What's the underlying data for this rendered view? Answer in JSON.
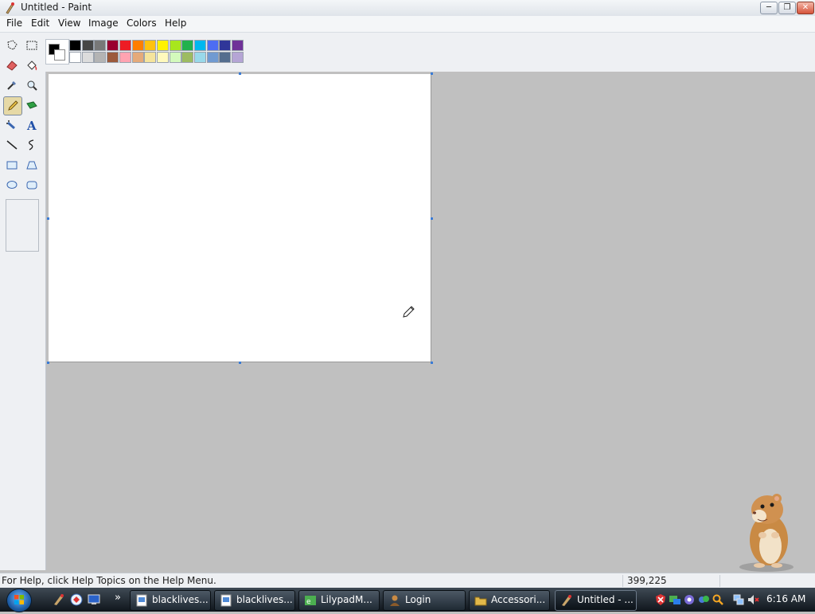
{
  "window": {
    "title": "Untitled - Paint",
    "minimize_glyph": "─",
    "restore_glyph": "❐",
    "close_glyph": "✕"
  },
  "menubar": {
    "items": [
      "File",
      "Edit",
      "View",
      "Image",
      "Colors",
      "Help"
    ]
  },
  "toolbox": {
    "tools": [
      "free-form-select",
      "select",
      "eraser",
      "fill-with-color",
      "pick-color",
      "magnifier",
      "pencil",
      "brush",
      "airbrush",
      "text",
      "line",
      "curve",
      "rectangle",
      "polygon",
      "ellipse",
      "rounded-rectangle"
    ],
    "active_tool": "pencil"
  },
  "palette": {
    "foreground": "#000000",
    "background": "#ffffff",
    "row1": [
      "#000000",
      "#464646",
      "#787878",
      "#990030",
      "#ed1c24",
      "#ff7e00",
      "#ffc20e",
      "#fff200",
      "#a8e61d",
      "#22b14c",
      "#00b7ef",
      "#4d6df3",
      "#2f3699",
      "#6f3198"
    ],
    "row2": [
      "#ffffff",
      "#dcdcdc",
      "#b4b4b4",
      "#9c5a3c",
      "#ffa3b1",
      "#e5aa7a",
      "#f5e49c",
      "#fff9bd",
      "#d3f9bc",
      "#9dbb61",
      "#99d9ea",
      "#709ad1",
      "#546d8e",
      "#b5a5d5"
    ]
  },
  "statusbar": {
    "help_text": "For Help, click Help Topics on the Help Menu.",
    "coordinates": "399,225"
  },
  "taskbar": {
    "buttons": [
      {
        "label": "blacklives...",
        "icon": "image-file-icon",
        "active": false
      },
      {
        "label": "blacklives...",
        "icon": "image-file-icon",
        "active": false
      },
      {
        "label": "LilypadM...",
        "icon": "browser-icon",
        "active": false
      },
      {
        "label": "Login",
        "icon": "user-icon",
        "active": false
      },
      {
        "label": "Accessori...",
        "icon": "folder-icon",
        "active": false
      },
      {
        "label": "Untitled - ...",
        "icon": "paint-icon",
        "active": true
      }
    ],
    "overflow_glyph": "»",
    "clock": "6:16 AM"
  }
}
